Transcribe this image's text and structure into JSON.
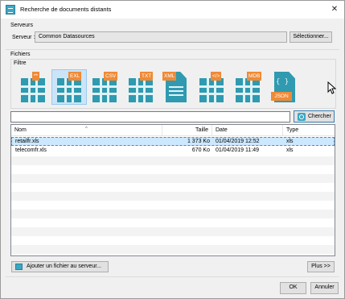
{
  "window": {
    "title": "Recherche de documents distants",
    "close_glyph": "✕"
  },
  "servers": {
    "group_label": "Serveurs",
    "label": "Serveur :",
    "value": "Common Datasources",
    "select_button": "Sélectionner..."
  },
  "files": {
    "group_label": "Fichiers",
    "filter_label": "Filtre",
    "filter_icons": [
      {
        "tag": "**",
        "icon": "all-files-icon"
      },
      {
        "tag": "EXL",
        "icon": "excel-file-icon"
      },
      {
        "tag": "CSV",
        "icon": "csv-file-icon"
      },
      {
        "tag": "TXT",
        "icon": "txt-file-icon"
      },
      {
        "tag": "XML",
        "icon": "xml-file-icon"
      },
      {
        "tag": "</>",
        "icon": "html-file-icon"
      },
      {
        "tag": "MDB",
        "icon": "mdb-file-icon"
      },
      {
        "tag": "JSON",
        "icon": "json-file-icon"
      }
    ],
    "selected_filter": "EXL",
    "search_value": "",
    "search_button": "Chercher"
  },
  "table": {
    "columns": [
      "Nom",
      "Taille",
      "Date",
      "Type"
    ],
    "rows": [
      {
        "name": "retailfr.xls",
        "size": "1 373 Ko",
        "date": "01/04/2019 12:52",
        "type": "xls"
      },
      {
        "name": "telecomfr.xls",
        "size": "670 Ko",
        "date": "01/04/2019 11:49",
        "type": "xls"
      }
    ],
    "selected_row": 0
  },
  "footer": {
    "add_button": "Ajouter un fichier au serveur...",
    "more_button": "Plus >>",
    "ok_button": "OK",
    "cancel_button": "Annuler"
  },
  "colors": {
    "icon_teal": "#2f9ab0",
    "icon_orange": "#f08a36",
    "selection": "#cce8ff"
  }
}
